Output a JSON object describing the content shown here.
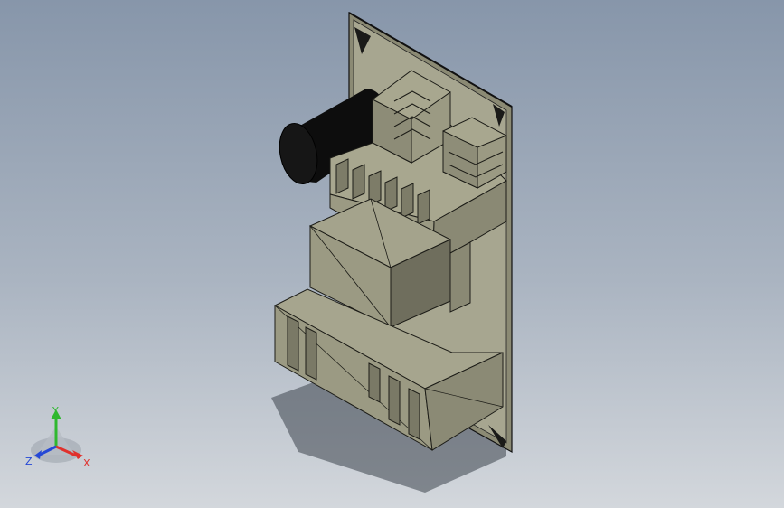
{
  "colors": {
    "body_fill": "#9b9a83",
    "body_light": "#a8a78f",
    "body_dark": "#6e6d5c",
    "edge": "#1c1c17",
    "shadow": "#3a3f47",
    "capacitor": "#0d0d0d",
    "axis_x": "#e0302c",
    "axis_y": "#2fb82f",
    "axis_z": "#2548d6"
  },
  "triad": {
    "x_label": "X",
    "y_label": "Y",
    "z_label": "Z"
  }
}
